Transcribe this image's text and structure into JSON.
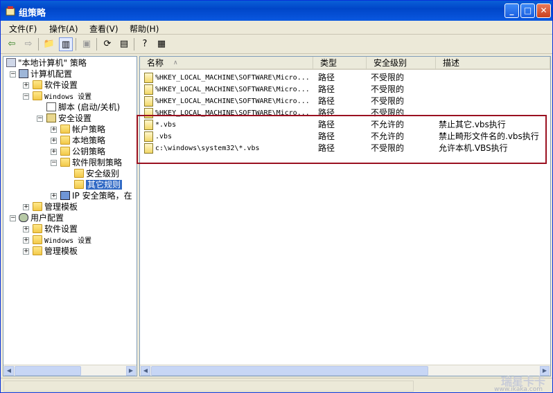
{
  "window": {
    "title": "组策略",
    "min": "_",
    "max": "□",
    "close": "✕"
  },
  "menu": [
    "文件(F)",
    "操作(A)",
    "查看(V)",
    "帮助(H)"
  ],
  "tree": {
    "root": "\"本地计算机\" 策略",
    "computer": "计算机配置",
    "software": "软件设置",
    "windows": "Windows 设置",
    "scripts": "脚本 (启动/关机)",
    "security": "安全设置",
    "account": "帐户策略",
    "local": "本地策略",
    "pubkey": "公钥策略",
    "srp": "软件限制策略",
    "seclevels": "安全级别",
    "other": "其它规则",
    "ipsec": "IP 安全策略，在",
    "admin": "管理模板",
    "user": "用户配置",
    "u_software": "软件设置",
    "u_windows": "Windows 设置",
    "u_admin": "管理模板"
  },
  "columns": {
    "name": "名称",
    "type": "类型",
    "level": "安全级别",
    "desc": "描述"
  },
  "rows": [
    {
      "name": "%HKEY_LOCAL_MACHINE\\SOFTWARE\\Micro...",
      "type": "路径",
      "level": "不受限的",
      "desc": ""
    },
    {
      "name": "%HKEY_LOCAL_MACHINE\\SOFTWARE\\Micro...",
      "type": "路径",
      "level": "不受限的",
      "desc": ""
    },
    {
      "name": "%HKEY_LOCAL_MACHINE\\SOFTWARE\\Micro...",
      "type": "路径",
      "level": "不受限的",
      "desc": ""
    },
    {
      "name": "%HKEY_LOCAL_MACHINE\\SOFTWARE\\Micro...",
      "type": "路径",
      "level": "不受限的",
      "desc": ""
    },
    {
      "name": "*.vbs",
      "type": "路径",
      "level": "不允许的",
      "desc": "禁止其它.vbs执行"
    },
    {
      "name": ".vbs",
      "type": "路径",
      "level": "不允许的",
      "desc": "禁止畸形文件名的.vbs执行"
    },
    {
      "name": "c:\\windows\\system32\\*.vbs",
      "type": "路径",
      "level": "不受限的",
      "desc": "允许本机.VBS执行"
    }
  ],
  "watermark": {
    "brand": "瑞星卡卡",
    "url": "www.ikaka.com"
  }
}
